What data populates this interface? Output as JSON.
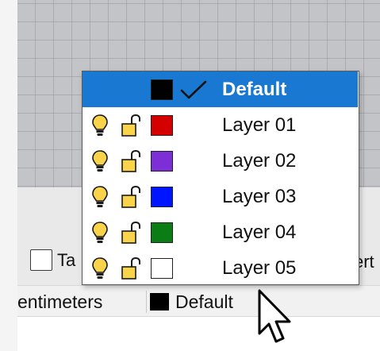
{
  "viewport": {
    "grid_color": "#c3c4c8"
  },
  "layer_dropdown": {
    "selected_layer": "Default",
    "layers": [
      {
        "name": "Default",
        "color": "#000000",
        "selected": true
      },
      {
        "name": "Layer 01",
        "color": "#d40000",
        "visible_icon": "lightbulb-icon",
        "lock_icon": "unlocked-padlock-icon"
      },
      {
        "name": "Layer 02",
        "color": "#7d2ed6",
        "visible_icon": "lightbulb-icon",
        "lock_icon": "unlocked-padlock-icon"
      },
      {
        "name": "Layer 03",
        "color": "#0015ff",
        "visible_icon": "lightbulb-icon",
        "lock_icon": "unlocked-padlock-icon"
      },
      {
        "name": "Layer 04",
        "color": "#0a7d14",
        "visible_icon": "lightbulb-icon",
        "lock_icon": "unlocked-padlock-icon"
      },
      {
        "name": "Layer 05",
        "color": "#ffffff",
        "visible_icon": "lightbulb-icon",
        "lock_icon": "unlocked-padlock-icon"
      }
    ],
    "accent_color": "#1979d2"
  },
  "lower_panel": {
    "checkbox_label_partial": "Ta",
    "right_label_partial": "ert"
  },
  "status_bar": {
    "units": "entimeters",
    "current_layer": "Default",
    "current_layer_color": "#000000"
  }
}
